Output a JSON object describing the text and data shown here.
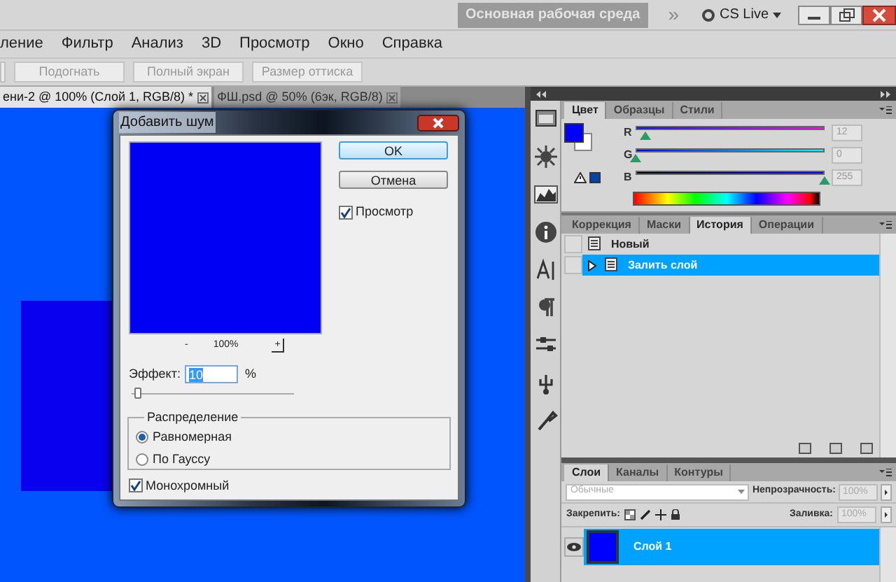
{
  "top_bar": {
    "workspace_button": "Основная рабочая среда",
    "overflow": "»",
    "cs_live": "CS Live"
  },
  "menu": [
    "ление",
    "Фильтр",
    "Анализ",
    "3D",
    "Просмотр",
    "Окно",
    "Справка"
  ],
  "options_buttons": [
    "Подогнать",
    "Полный экран",
    "Размер оттиска"
  ],
  "document_tabs": [
    {
      "label": "ени-2 @ 100% (Слой 1, RGB/8) *",
      "selected": true
    },
    {
      "label": "ФШ.psd @ 50% (6эк, RGB/8)",
      "selected": false
    }
  ],
  "color_panel": {
    "tabs": [
      {
        "label": "Цвет",
        "selected": true
      },
      {
        "label": "Образцы",
        "selected": false
      },
      {
        "label": "Стили",
        "selected": false
      }
    ],
    "channels": [
      {
        "label": "R",
        "value": "12",
        "level": 0.05
      },
      {
        "label": "G",
        "value": "0",
        "level": 0
      },
      {
        "label": "B",
        "value": "255",
        "level": 1
      }
    ]
  },
  "history_panel": {
    "tabs": [
      {
        "label": "Коррекция",
        "selected": false
      },
      {
        "label": "Маски",
        "selected": false
      },
      {
        "label": "История",
        "selected": true
      },
      {
        "label": "Операции",
        "selected": false
      }
    ],
    "items": [
      {
        "label": "Новый",
        "selected": false
      },
      {
        "label": "Залить слой",
        "selected": true
      }
    ]
  },
  "layers_panel": {
    "tabs": [
      {
        "label": "Слои",
        "selected": true
      },
      {
        "label": "Каналы",
        "selected": false
      },
      {
        "label": "Контуры",
        "selected": false
      }
    ],
    "blend_mode": "Обычные",
    "opacity_label": "Непрозрачность:",
    "opacity": "100%",
    "lock_label": "Закрепить:",
    "fill_label": "Заливка:",
    "fill": "100%",
    "layers": [
      {
        "name": "Слой 1",
        "visible": true,
        "selected": true
      }
    ]
  },
  "dialog": {
    "title": "Добавить шум",
    "buttons": [
      "OK",
      "Отмена"
    ],
    "preview": {
      "label": "Просмотр",
      "checked": true
    },
    "zoom_out": "-",
    "zoom": "100%",
    "zoom_in": "+",
    "amount_label": "Эффект:",
    "amount": "10",
    "unit": "%",
    "amount_slider": {
      "level": 0.02
    },
    "distribution": {
      "legend": "Распределение",
      "options": [
        {
          "label": "Равномерная",
          "selected": true
        },
        {
          "label": "По Гауссу",
          "selected": false
        }
      ]
    },
    "monochromatic": {
      "label": "Монохромный",
      "checked": true
    }
  }
}
